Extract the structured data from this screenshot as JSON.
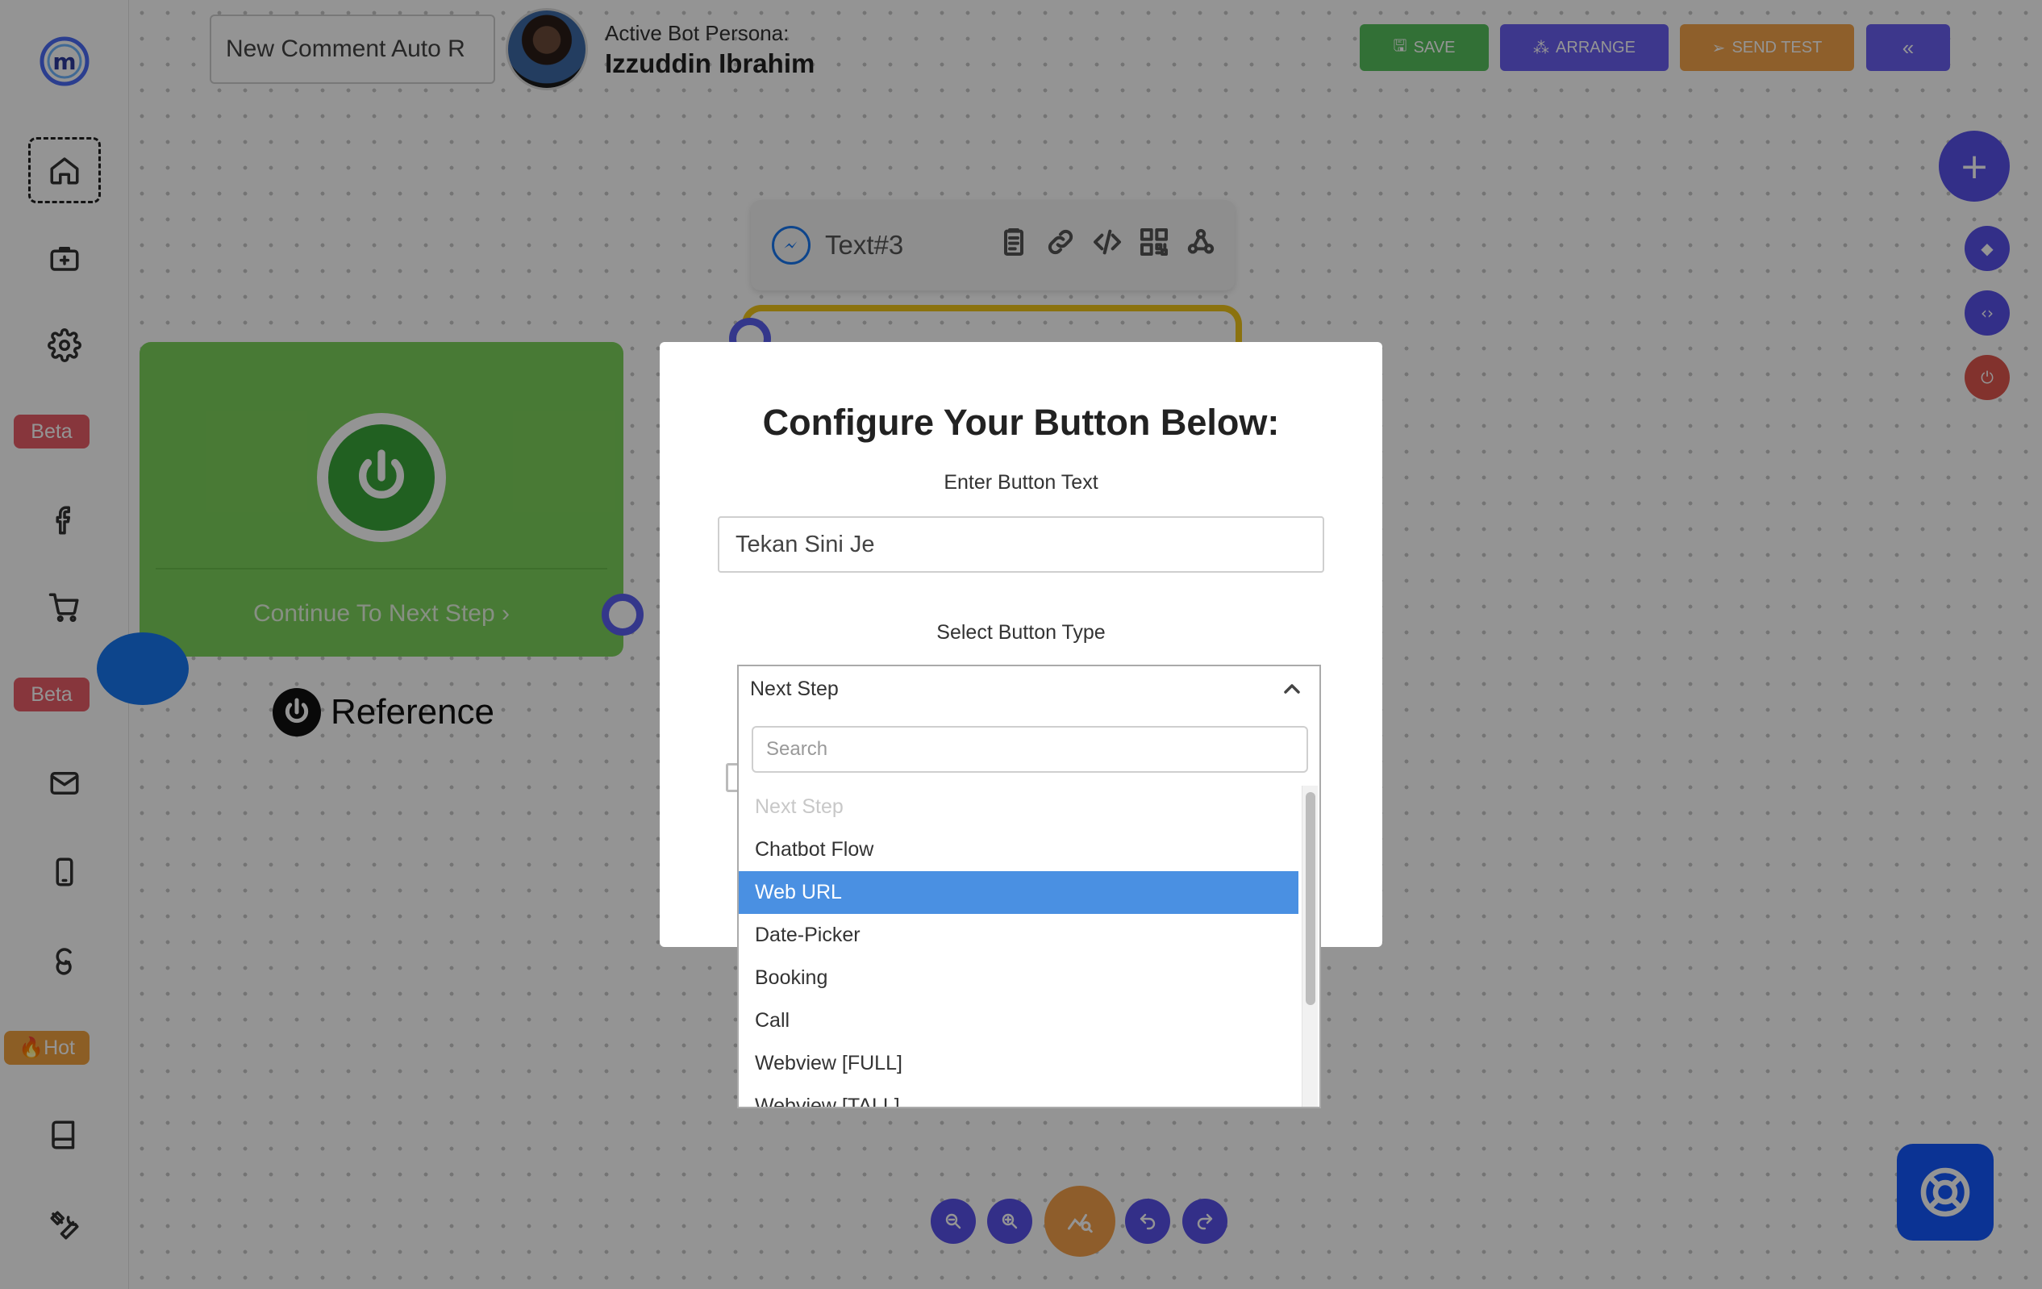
{
  "flow": {
    "name": "New Comment Auto R"
  },
  "persona": {
    "label": "Active Bot Persona:",
    "name": "Izzuddin Ibrahim"
  },
  "toolbar": {
    "save_label": "SAVE",
    "arrange_label": "ARRANGE",
    "send_test_label": "SEND TEST",
    "collapse_label": "«"
  },
  "sidebar": {
    "badges": {
      "beta_1": "Beta",
      "beta_2": "Beta",
      "hot": "🔥Hot"
    }
  },
  "fab": {
    "add_label": "+"
  },
  "nodes": {
    "text_node_title": "Text#3",
    "start_continue": "Continue To Next Step ›",
    "reference_label": "Reference"
  },
  "modal": {
    "title": "Configure Your Button Below:",
    "button_text_label": "Enter Button Text",
    "button_text_value": "Tekan Sini Je",
    "button_type_label": "Select Button Type",
    "selected_type": "Next Step",
    "search_placeholder": "Search",
    "options": [
      "Next Step",
      "Chatbot Flow",
      "Web URL",
      "Date-Picker",
      "Booking",
      "Call",
      "Webview [FULL]",
      "Webview [TALL]"
    ]
  },
  "colors": {
    "save": "#56c15e",
    "arrange": "#6a5ff2",
    "send_test": "#f5a44a",
    "start_node": "#7dd35c",
    "option_highlight": "#4a90e2"
  }
}
